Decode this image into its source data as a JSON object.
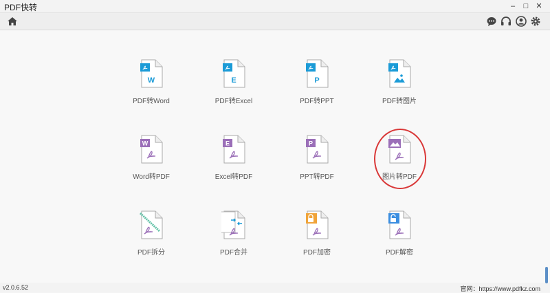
{
  "window": {
    "title": "PDF快转",
    "minimize": "–",
    "maximize": "□",
    "close": "✕"
  },
  "toolbar": {
    "home_icon": "home-icon",
    "right_icons": [
      "chat-icon",
      "headset-icon",
      "user-icon",
      "gear-icon"
    ]
  },
  "tools": [
    {
      "id": "pdf-to-word",
      "label": "PDF转Word",
      "badge": "W",
      "colors": {
        "tag": "#1b9bd7",
        "badge": "#1b9bd7"
      }
    },
    {
      "id": "pdf-to-excel",
      "label": "PDF转Excel",
      "badge": "E",
      "colors": {
        "tag": "#1b9bd7",
        "badge": "#1b9bd7"
      }
    },
    {
      "id": "pdf-to-ppt",
      "label": "PDF转PPT",
      "badge": "P",
      "colors": {
        "tag": "#1b9bd7",
        "badge": "#1b9bd7"
      }
    },
    {
      "id": "pdf-to-image",
      "label": "PDF转图片",
      "badge": "image",
      "colors": {
        "tag": "#1b9bd7",
        "badge": "#1b9bd7"
      }
    },
    {
      "id": "word-to-pdf",
      "label": "Word转PDF",
      "badge": "W",
      "colors": {
        "tag": "#9b6fb8",
        "badge": "#9b6fb8"
      }
    },
    {
      "id": "excel-to-pdf",
      "label": "Excel转PDF",
      "badge": "E",
      "colors": {
        "tag": "#9b6fb8",
        "badge": "#9b6fb8"
      }
    },
    {
      "id": "ppt-to-pdf",
      "label": "PPT转PDF",
      "badge": "P",
      "colors": {
        "tag": "#9b6fb8",
        "badge": "#9b6fb8"
      }
    },
    {
      "id": "image-to-pdf",
      "label": "图片转PDF",
      "badge": "image",
      "colors": {
        "tag": "#9b6fb8",
        "badge": "#9b6fb8"
      },
      "highlighted": true
    },
    {
      "id": "pdf-split",
      "label": "PDF拆分",
      "badge": "split",
      "colors": {
        "tag": "#63c2a8",
        "badge": "#9b6fb8"
      }
    },
    {
      "id": "pdf-merge",
      "label": "PDF合并",
      "badge": "merge",
      "colors": {
        "tag": "#1b9bd7",
        "badge": "#9b6fb8"
      }
    },
    {
      "id": "pdf-encrypt",
      "label": "PDF加密",
      "badge": "lock",
      "colors": {
        "tag": "#f0a43a",
        "badge": "#9b6fb8"
      }
    },
    {
      "id": "pdf-decrypt",
      "label": "PDF解密",
      "badge": "unlock",
      "colors": {
        "tag": "#3b8ee0",
        "badge": "#9b6fb8"
      }
    }
  ],
  "status": {
    "version": "v2.0.6.52",
    "website": "官网：https://www.pdfkz.com"
  }
}
